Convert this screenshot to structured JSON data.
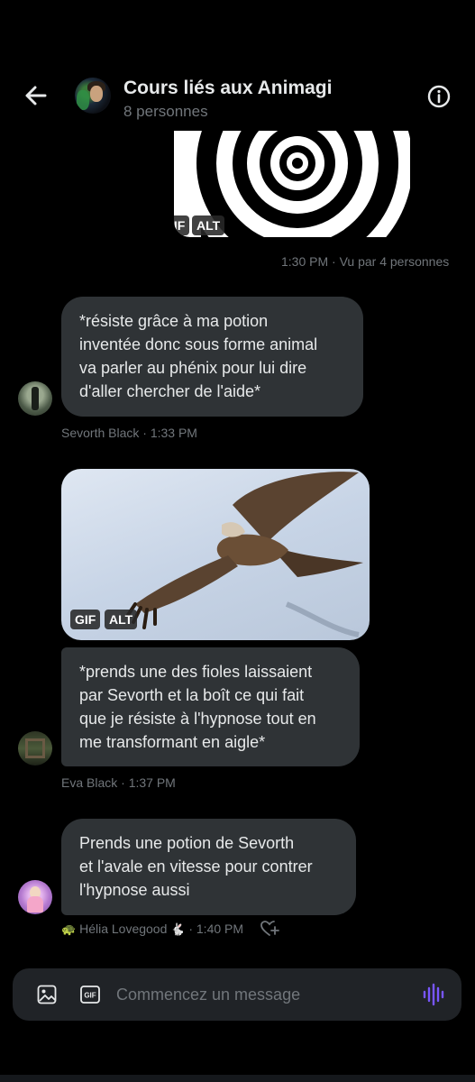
{
  "header": {
    "title": "Cours liés aux Animagi",
    "subtitle": "8 personnes"
  },
  "messages": {
    "gif1": {
      "badge_gif": "GIF",
      "badge_alt": "ALT",
      "time": "1:30 PM · Vu par 4 personnes"
    },
    "m1": {
      "text": "*résiste grâce à ma potion\ninventée donc sous forme animal\nva parler au phénix pour lui dire\nd'aller chercher de l'aide*",
      "meta": "Sevorth Black · 1:33 PM"
    },
    "gif2": {
      "badge_gif": "GIF",
      "badge_alt": "ALT"
    },
    "m2": {
      "text": "*prends une des fioles laissaient\npar Sevorth et la boît ce qui fait\nque je résiste à l'hypnose tout en\nme transformant en aigle*",
      "meta": "Eva Black · 1:37 PM"
    },
    "m3": {
      "text": "Prends une potion de Sevorth\net l'avale en vitesse pour contrer\nl'hypnose aussi",
      "author": "Hélia Lovegood",
      "time": "· 1:40 PM"
    }
  },
  "composer": {
    "placeholder": "Commencez un message"
  },
  "icons": {
    "back": "arrow-left-icon",
    "info": "info-icon",
    "image": "image-icon",
    "gif": "gif-icon",
    "voice": "voice-wave-icon",
    "reaction": "add-reaction-icon",
    "turtle": "turtle-emoji",
    "rabbit": "rabbit-emoji"
  },
  "colors": {
    "background": "#000000",
    "bubble": "#2f3336",
    "muted": "#71767b",
    "accent": "#7856ff"
  }
}
